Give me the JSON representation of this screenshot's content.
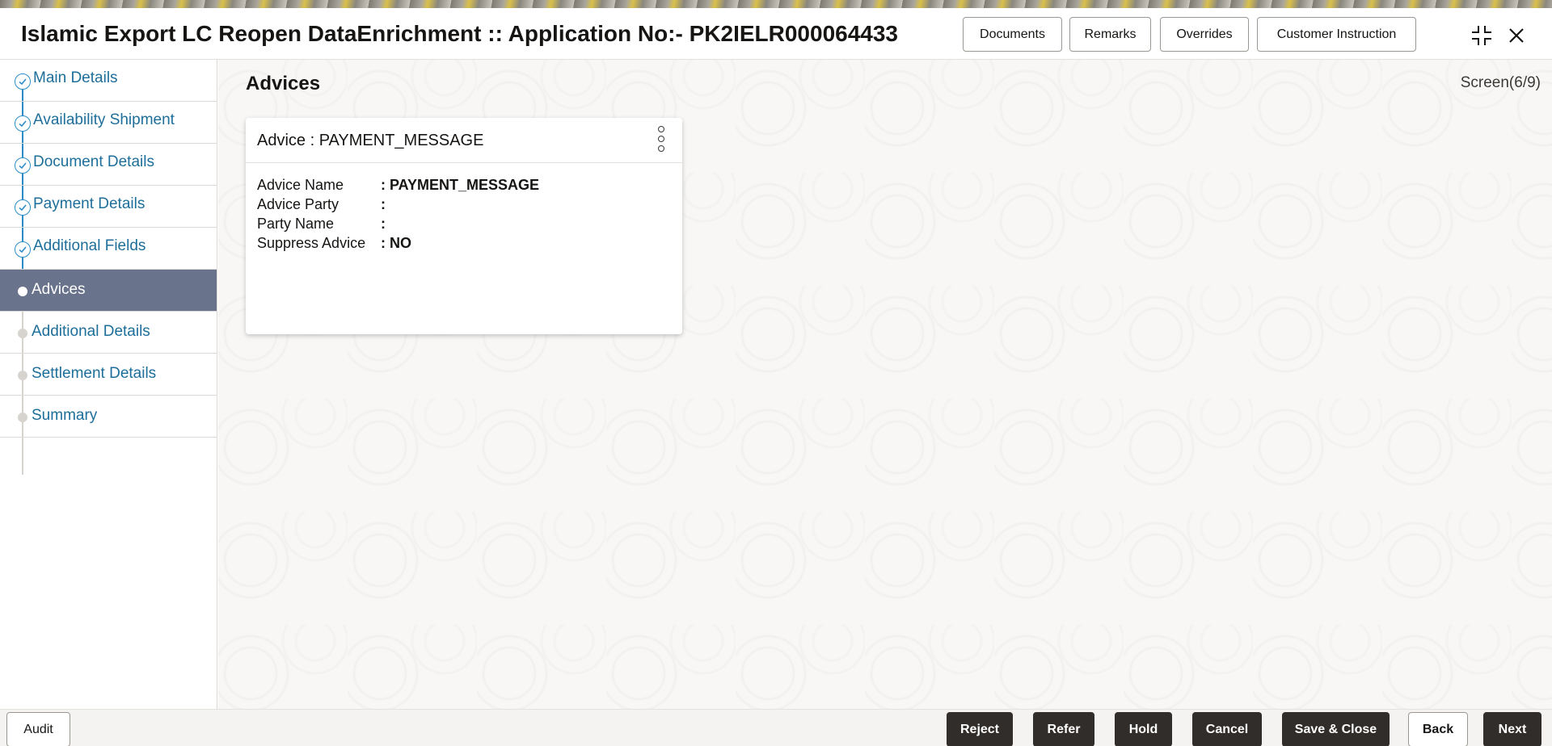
{
  "header": {
    "title": "Islamic Export LC Reopen DataEnrichment :: Application No:- PK2IELR000064433",
    "buttons": {
      "documents": "Documents",
      "remarks": "Remarks",
      "overrides": "Overrides",
      "customer_instruction": "Customer Instruction"
    },
    "icons": [
      "collapse-icon",
      "close-icon"
    ]
  },
  "sidebar": {
    "items": [
      {
        "label": "Main Details",
        "state": "done"
      },
      {
        "label": "Availability Shipment",
        "state": "done"
      },
      {
        "label": "Document Details",
        "state": "done"
      },
      {
        "label": "Payment Details",
        "state": "done"
      },
      {
        "label": "Additional Fields",
        "state": "done"
      },
      {
        "label": "Advices",
        "state": "active"
      },
      {
        "label": "Additional Details",
        "state": "pending"
      },
      {
        "label": "Settlement Details",
        "state": "pending"
      },
      {
        "label": "Summary",
        "state": "pending"
      }
    ]
  },
  "main": {
    "section_title": "Advices",
    "screen_count": "Screen(6/9)",
    "card": {
      "title": "Advice : PAYMENT_MESSAGE",
      "fields": [
        {
          "label": "Advice Name",
          "value": ": PAYMENT_MESSAGE"
        },
        {
          "label": "Advice Party",
          "value": ":"
        },
        {
          "label": "Party Name",
          "value": ":"
        },
        {
          "label": "Suppress Advice",
          "value": ": NO"
        }
      ]
    }
  },
  "footer": {
    "audit": "Audit",
    "reject": "Reject",
    "refer": "Refer",
    "hold": "Hold",
    "cancel": "Cancel",
    "save_close": "Save & Close",
    "back": "Back",
    "next": "Next"
  },
  "colors": {
    "accent": "#2b8dc7",
    "active_nav_bg": "#6a738c",
    "dark_button": "#312d2a"
  }
}
